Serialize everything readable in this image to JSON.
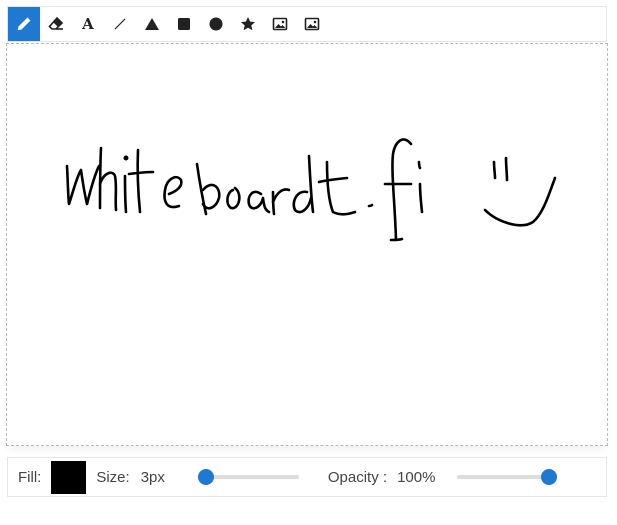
{
  "toolbar": {
    "tools": [
      {
        "icon": "pencil-icon",
        "active": true
      },
      {
        "icon": "eraser-icon",
        "active": false
      },
      {
        "icon": "text-icon",
        "label": "A",
        "active": false
      },
      {
        "icon": "line-icon",
        "active": false
      },
      {
        "icon": "triangle-icon",
        "active": false
      },
      {
        "icon": "square-icon",
        "active": false
      },
      {
        "icon": "circle-icon",
        "active": false
      },
      {
        "icon": "star-icon",
        "active": false
      },
      {
        "icon": "image-icon",
        "active": false
      },
      {
        "icon": "image-icon",
        "active": false
      }
    ],
    "active_color": "#1f78d1"
  },
  "canvas": {
    "drawing": "handwritten whiteboard.fi with smiley face",
    "stroke_color": "#000000"
  },
  "options": {
    "fill_label": "Fill:",
    "fill_color": "#000000",
    "size_label": "Size:",
    "size_value": "3px",
    "size_slider_fraction": 0.03,
    "opacity_label": "Opacity :",
    "opacity_value": "100%",
    "opacity_slider_fraction": 1.0,
    "accent_color": "#1f78d1"
  }
}
